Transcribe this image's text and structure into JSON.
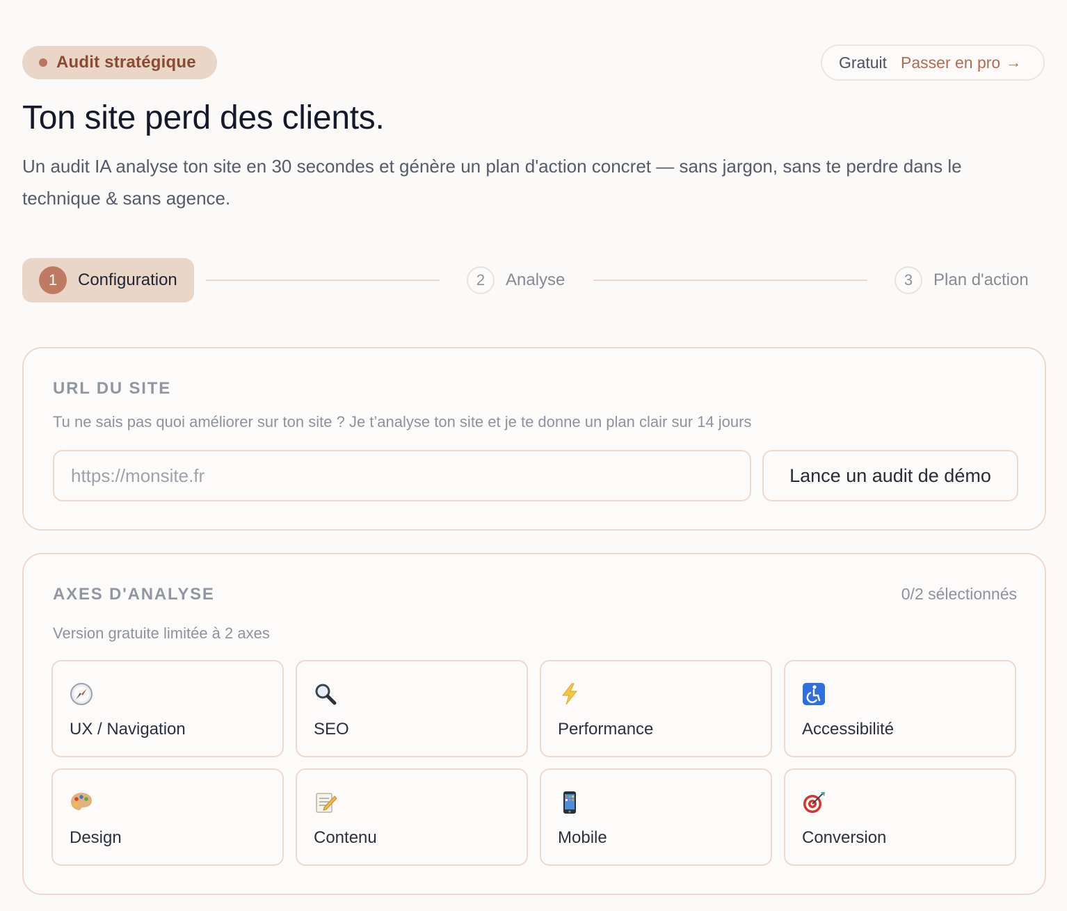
{
  "header": {
    "badge": "Audit stratégique",
    "plan_label": "Gratuit",
    "upgrade_label": "Passer en pro",
    "upgrade_arrow": "→",
    "title": "Ton site perd des clients.",
    "subtitle": "Un audit IA analyse ton site en 30 secondes et génère un plan d'action concret — sans jargon, sans te perdre dans le technique & sans agence."
  },
  "stepper": {
    "steps": [
      {
        "num": "1",
        "label": "Configuration",
        "active": true
      },
      {
        "num": "2",
        "label": "Analyse",
        "active": false
      },
      {
        "num": "3",
        "label": "Plan d'action",
        "active": false
      }
    ]
  },
  "url_section": {
    "title": "URL DU SITE",
    "description": "Tu ne sais pas quoi améliorer sur ton site ? Je t’analyse ton site et je te donne un plan clair sur 14 jours",
    "placeholder": "https://monsite.fr",
    "value": "",
    "demo_button": "Lance un audit de démo"
  },
  "axes_section": {
    "title": "AXES D'ANALYSE",
    "counter": "0/2 sélectionnés",
    "limit_note": "Version gratuite limitée à 2 axes",
    "axes": [
      {
        "label": "UX / Navigation",
        "icon": "compass-icon"
      },
      {
        "label": "SEO",
        "icon": "magnifier-icon"
      },
      {
        "label": "Performance",
        "icon": "lightning-icon"
      },
      {
        "label": "Accessibilité",
        "icon": "wheelchair-icon"
      },
      {
        "label": "Design",
        "icon": "palette-icon"
      },
      {
        "label": "Contenu",
        "icon": "memo-icon"
      },
      {
        "label": "Mobile",
        "icon": "smartphone-icon"
      },
      {
        "label": "Conversion",
        "icon": "target-icon"
      }
    ]
  },
  "colors": {
    "accent": "#be7a62",
    "accent_soft": "#ead6c6",
    "border": "#eed9cc",
    "background": "#fcfaf8"
  }
}
